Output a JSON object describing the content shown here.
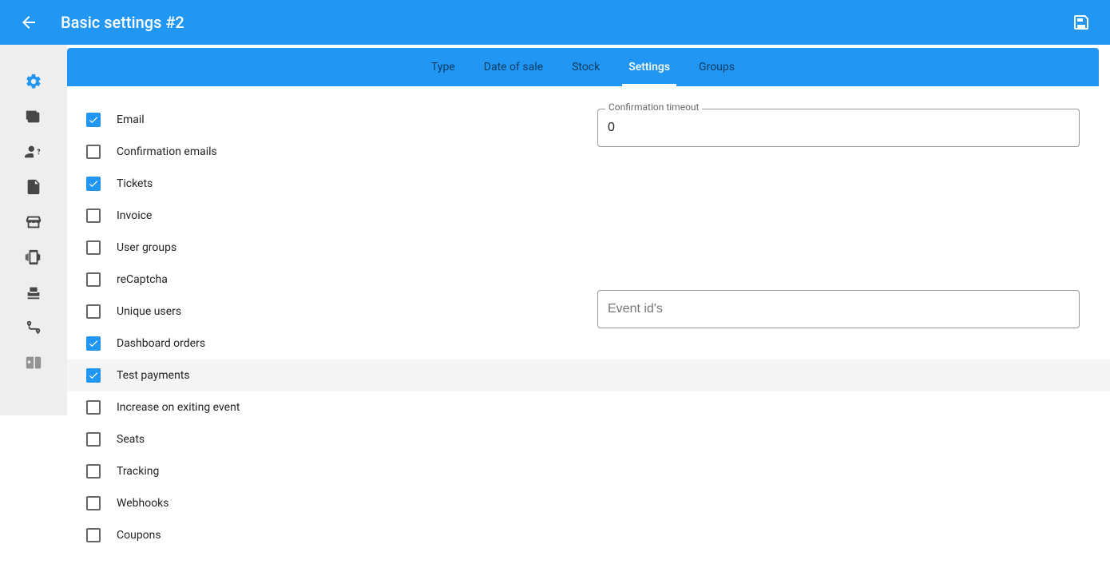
{
  "appbar": {
    "title": "Basic settings #2"
  },
  "tabs": {
    "t0": "Type",
    "t1": "Date of sale",
    "t2": "Stock",
    "t3": "Settings",
    "t4": "Groups"
  },
  "sidebar_icons": [
    "gear-icon",
    "email-icon",
    "user-question-icon",
    "pdf-icon",
    "storefront-icon",
    "phone-vibrate-icon",
    "seat-icon",
    "route-icon",
    "badge-icon"
  ],
  "settings": {
    "items": [
      {
        "key": "email",
        "label": "Email",
        "checked": true
      },
      {
        "key": "confirmation_emails",
        "label": "Confirmation emails",
        "checked": false
      },
      {
        "key": "tickets",
        "label": "Tickets",
        "checked": true
      },
      {
        "key": "invoice",
        "label": "Invoice",
        "checked": false
      },
      {
        "key": "user_groups",
        "label": "User groups",
        "checked": false
      },
      {
        "key": "recaptcha",
        "label": "reCaptcha",
        "checked": false
      },
      {
        "key": "unique_users",
        "label": "Unique users",
        "checked": false
      },
      {
        "key": "dashboard_orders",
        "label": "Dashboard orders",
        "checked": true
      },
      {
        "key": "test_payments",
        "label": "Test payments",
        "checked": true,
        "hovered": true
      },
      {
        "key": "increase_on_exiting_event",
        "label": "Increase on exiting event",
        "checked": false
      },
      {
        "key": "seats",
        "label": "Seats",
        "checked": false
      },
      {
        "key": "tracking",
        "label": "Tracking",
        "checked": false
      },
      {
        "key": "webhooks",
        "label": "Webhooks",
        "checked": false
      },
      {
        "key": "coupons",
        "label": "Coupons",
        "checked": false
      }
    ]
  },
  "right": {
    "confirmation_timeout": {
      "label": "Confirmation timeout",
      "value": "0"
    },
    "event_ids": {
      "placeholder": "Event id's",
      "value": ""
    }
  }
}
